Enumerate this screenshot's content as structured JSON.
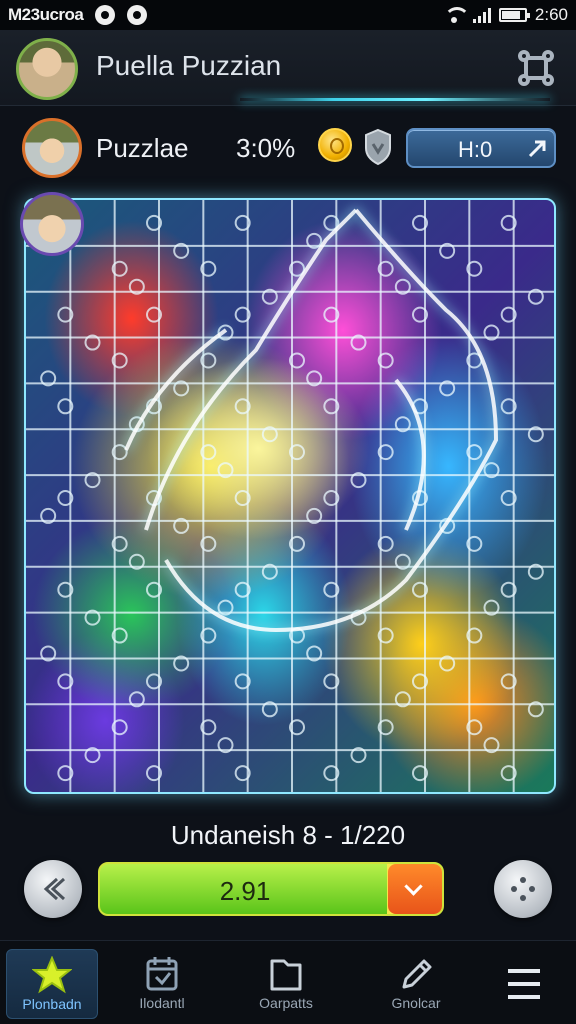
{
  "status_bar": {
    "carrier": "M23ucroa",
    "time": "2:60"
  },
  "header": {
    "title": "Puella Puzzian",
    "settings_icon": "settings-icon"
  },
  "player": {
    "name": "Puzzlae",
    "score": "3:0%",
    "timer": "H:0"
  },
  "progress": {
    "label": "Undaneish 8 - 1/220",
    "value_text": "2.91",
    "fill_fraction": 0.84
  },
  "bottom_nav": [
    {
      "label": "Plonbadn",
      "icon": "star-icon",
      "active": true
    },
    {
      "label": "Ilodantl",
      "icon": "calendar-icon",
      "active": false
    },
    {
      "label": "Oarpatts",
      "icon": "folder-icon",
      "active": false
    },
    {
      "label": "Gnolcar",
      "icon": "pencil-icon",
      "active": false
    },
    {
      "label": "",
      "icon": "menu-icon",
      "active": false
    }
  ],
  "colors": {
    "accent": "#3fd0e8",
    "coin": "#f1b000",
    "progress_green": "#5ac41a",
    "progress_end": "#e8541a"
  }
}
